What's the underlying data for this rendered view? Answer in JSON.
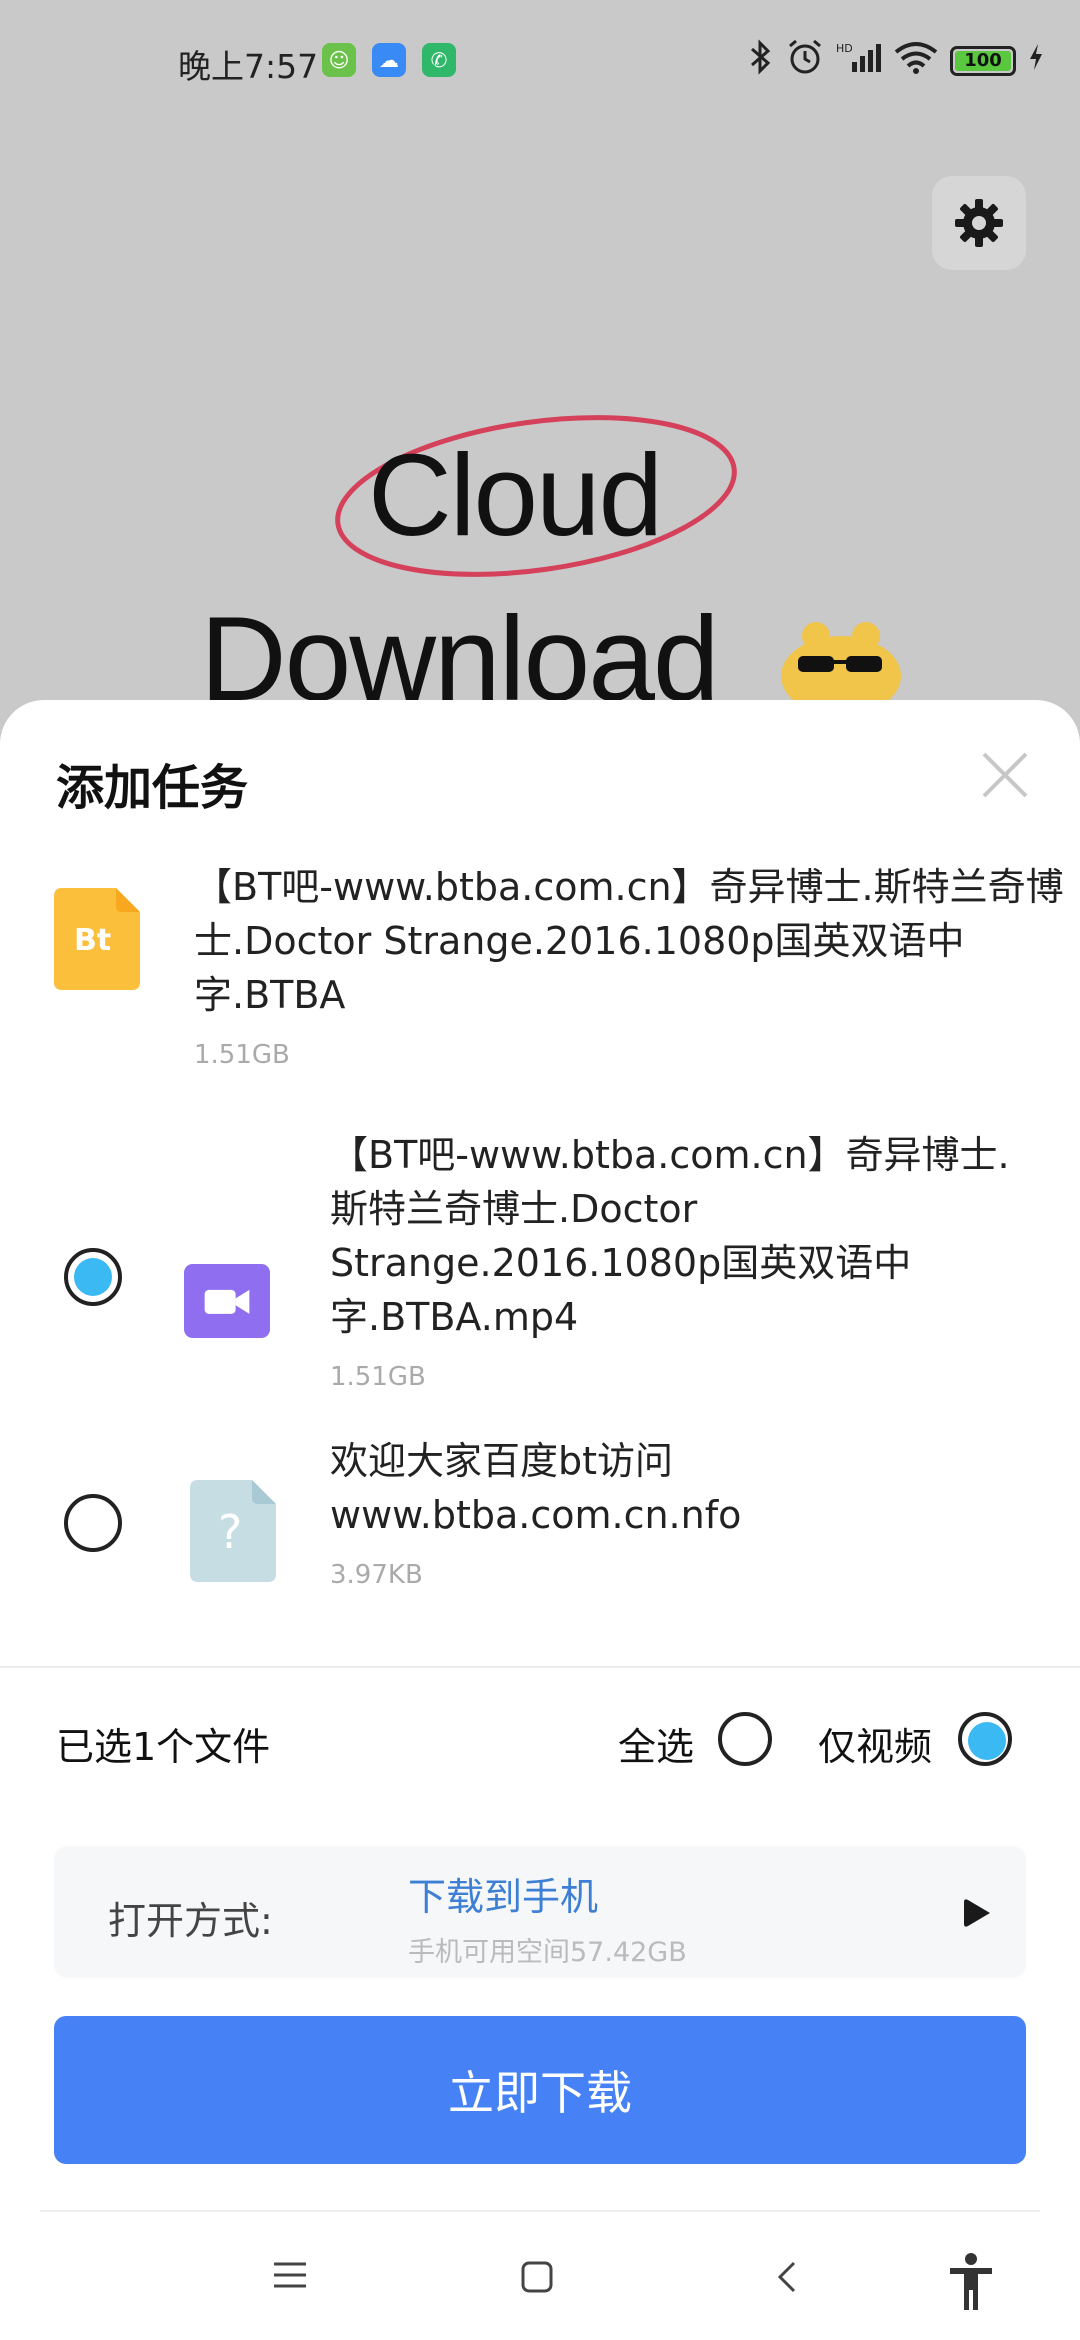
{
  "status_bar": {
    "time": "晚上7:57",
    "battery": "100",
    "app_badges": [
      "cat-app-icon",
      "cloud-app-icon",
      "phone-app-icon"
    ]
  },
  "background_app": {
    "logo_line1": "Cloud",
    "logo_line2": "Download"
  },
  "sheet": {
    "title": "添加任务",
    "torrent": {
      "icon_text": "Bt",
      "name": "【BT吧-www.btba.com.cn】奇异博士.斯特兰奇博士.Doctor Strange.2016.1080p国英双语中字.BTBA",
      "size": "1.51GB"
    },
    "files": [
      {
        "name": "【BT吧-www.btba.com.cn】奇异博士.斯特兰奇博士.Doctor Strange.2016.1080p国英双语中字.BTBA.mp4",
        "size": "1.51GB",
        "checked": true,
        "icon": "video-file-icon"
      },
      {
        "name": "欢迎大家百度bt访问www.btba.com.cn.nfo",
        "size": "3.97KB",
        "checked": false,
        "icon": "unknown-file-icon"
      }
    ],
    "selected_count": "已选1个文件",
    "select_all": "全选",
    "only_video": "仅视频",
    "open_with": {
      "label": "打开方式:",
      "value": "下载到手机",
      "space": "手机可用空间57.42GB"
    },
    "download_button": "立即下载"
  },
  "colors": {
    "accent": "#4682f5",
    "radio_fill": "#3bb9f3",
    "link": "#3d7fd4",
    "bt_icon": "#fbbf3c",
    "video_icon": "#8f6ff0"
  }
}
